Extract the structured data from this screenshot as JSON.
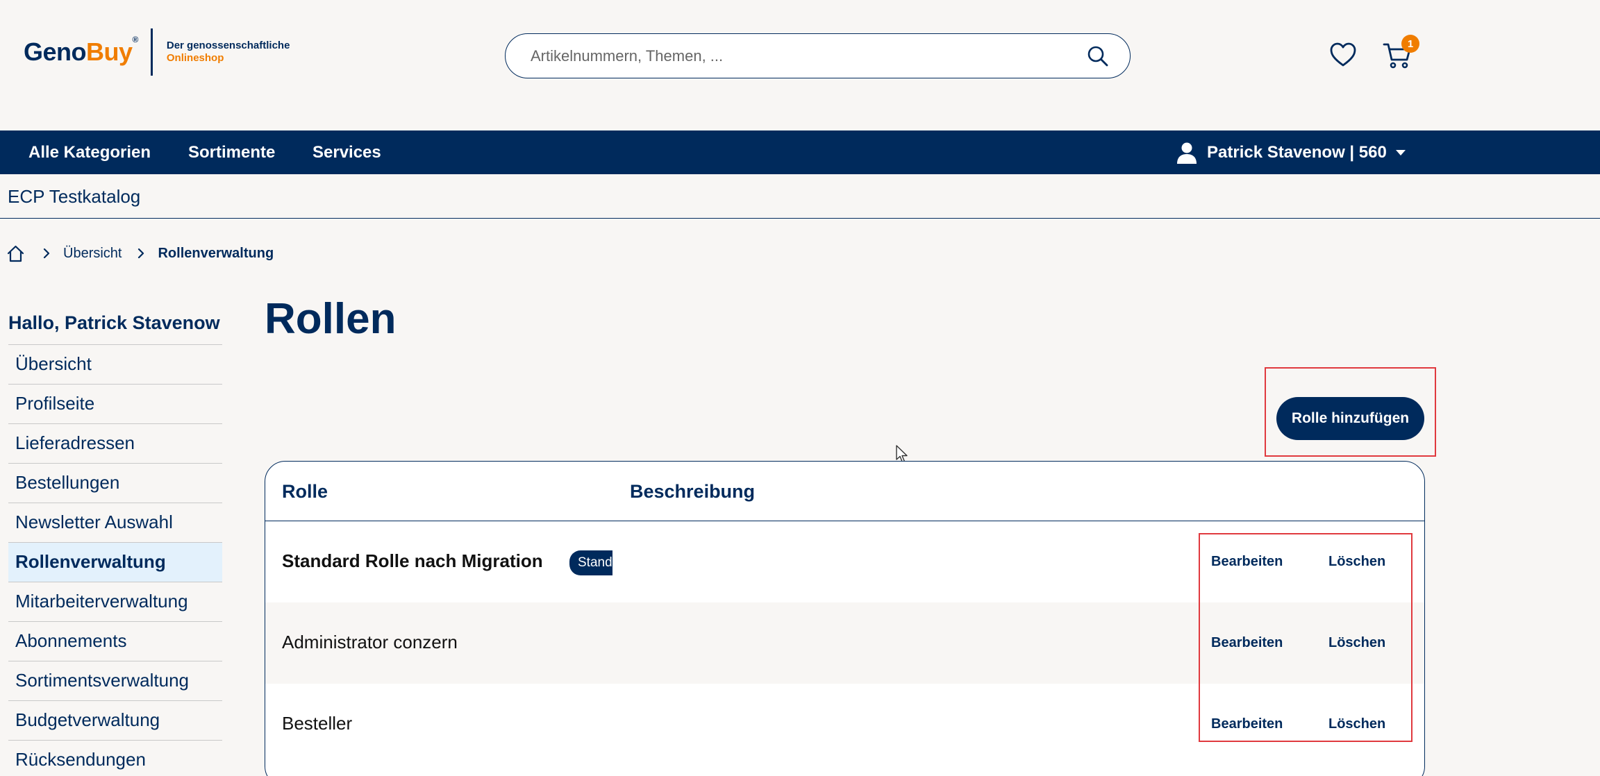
{
  "header": {
    "logo": {
      "geno": "Geno",
      "buy": "Buy",
      "reg": "®",
      "tagline_1": "Der genossenschaftliche",
      "tagline_2": "Onlineshop"
    },
    "search": {
      "placeholder": "Artikelnummern, Themen, ...",
      "value": ""
    },
    "cart_count": "1"
  },
  "nav": {
    "items": [
      "Alle Kategorien",
      "Sortimente",
      "Services"
    ],
    "user": "Patrick Stavenow | 560"
  },
  "catalog": {
    "title": "ECP Testkatalog"
  },
  "breadcrumb": {
    "overview": "Übersicht",
    "current": "Rollenverwaltung"
  },
  "sidebar": {
    "greeting": "Hallo, Patrick Stavenow",
    "items": [
      "Übersicht",
      "Profilseite",
      "Lieferadressen",
      "Bestellungen",
      "Newsletter Auswahl",
      "Rollenverwaltung",
      "Mitarbeiterverwaltung",
      "Abonnements",
      "Sortimentsverwaltung",
      "Budgetverwaltung",
      "Rücksendungen"
    ],
    "active_index": 5
  },
  "main": {
    "title": "Rollen",
    "add_button": "Rolle hinzufügen",
    "table": {
      "headers": {
        "role": "Rolle",
        "description": "Beschreibung"
      },
      "rows": [
        {
          "name": "Standard Rolle nach Migration",
          "badge": "Stand",
          "edit": "Bearbeiten",
          "delete": "Löschen"
        },
        {
          "name": "Administrator conzern",
          "edit": "Bearbeiten",
          "delete": "Löschen"
        },
        {
          "name": "Besteller",
          "edit": "Bearbeiten",
          "delete": "Löschen"
        }
      ]
    }
  },
  "colors": {
    "primary": "#002a5c",
    "accent": "#f07d00",
    "highlight": "#e0393e",
    "active_bg": "#e3f1fc",
    "page_bg": "#f8f6f4"
  }
}
